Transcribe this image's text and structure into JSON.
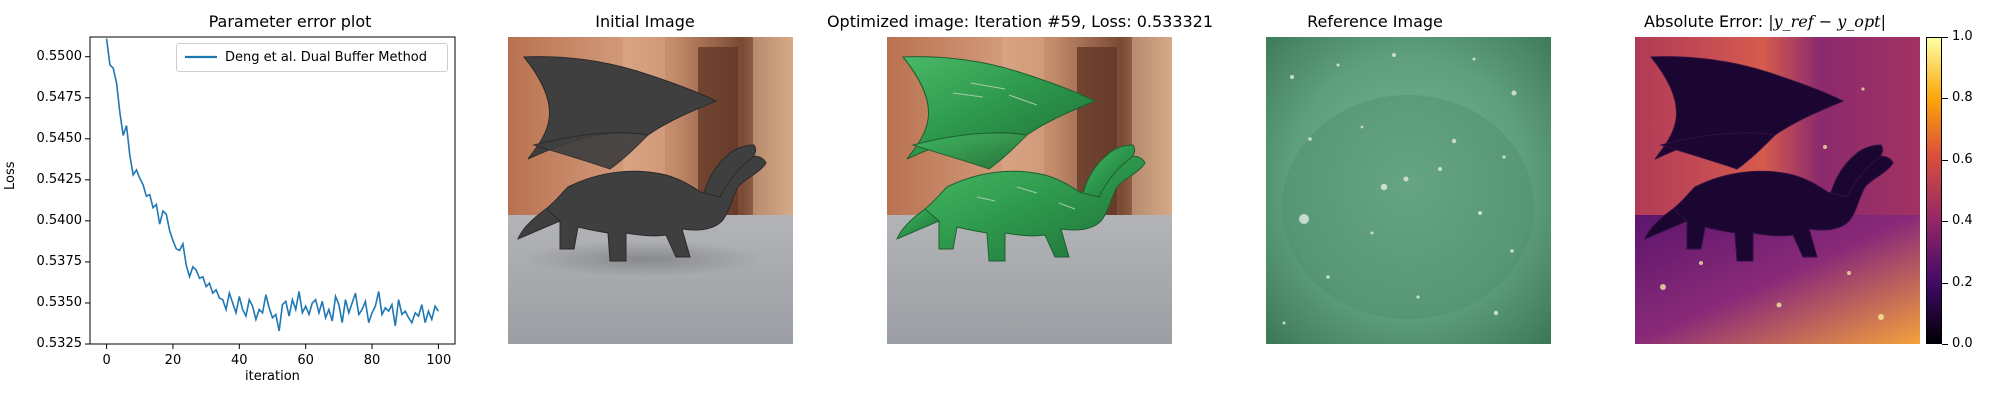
{
  "panels": {
    "plot": {
      "title": "Parameter error plot"
    },
    "initial": {
      "title": "Initial Image"
    },
    "optimized": {
      "title": "Optimized image: Iteration #59, Loss: 0.533321"
    },
    "reference": {
      "title": "Reference Image"
    },
    "error": {
      "title_prefix": "Absolute Error: ",
      "title_formula": "|y_ref − y_opt|"
    }
  },
  "colors": {
    "line": "#1f77b4",
    "sky_initial": "#c78663",
    "room_dark": "#4a2a20",
    "table_gray": "#a7a9ad",
    "dragon_gray": "#3a3a3a",
    "dragon_green": "#2e9a4d",
    "reference_green": "#5c9c7a",
    "inferno_top": "#fcffa4",
    "inferno_mid": "#bc3754",
    "inferno_bottom": "#000004"
  },
  "chart_data": [
    {
      "type": "line",
      "title": "Parameter error plot",
      "xlabel": "iteration",
      "ylabel": "Loss",
      "xlim": [
        -5,
        105
      ],
      "ylim": [
        0.5325,
        0.5512
      ],
      "xticks": [
        "0",
        "20",
        "40",
        "60",
        "80",
        "100"
      ],
      "yticks": [
        "0.5325",
        "0.5350",
        "0.5375",
        "0.5400",
        "0.5425",
        "0.5450",
        "0.5475",
        "0.5500"
      ],
      "legend": "top-right",
      "grid": false,
      "series": [
        {
          "name": "Deng et al. Dual Buffer Method",
          "x": [
            0,
            1,
            2,
            3,
            4,
            5,
            6,
            7,
            8,
            9,
            10,
            11,
            12,
            13,
            14,
            15,
            16,
            17,
            18,
            19,
            20,
            21,
            22,
            23,
            24,
            25,
            26,
            27,
            28,
            29,
            30,
            31,
            32,
            33,
            34,
            35,
            36,
            37,
            38,
            39,
            40,
            41,
            42,
            43,
            44,
            45,
            46,
            47,
            48,
            49,
            50,
            51,
            52,
            53,
            54,
            55,
            56,
            57,
            58,
            59,
            60,
            61,
            62,
            63,
            64,
            65,
            66,
            67,
            68,
            69,
            70,
            71,
            72,
            73,
            74,
            75,
            76,
            77,
            78,
            79,
            80,
            81,
            82,
            83,
            84,
            85,
            86,
            87,
            88,
            89,
            90,
            91,
            92,
            93,
            94,
            95,
            96,
            97,
            98,
            99,
            100
          ],
          "values": [
            0.5511,
            0.5495,
            0.5493,
            0.5484,
            0.5466,
            0.5452,
            0.5458,
            0.544,
            0.5428,
            0.5431,
            0.5426,
            0.5422,
            0.5415,
            0.5416,
            0.5408,
            0.541,
            0.5398,
            0.5406,
            0.5404,
            0.5394,
            0.5388,
            0.5383,
            0.5382,
            0.5386,
            0.5373,
            0.5366,
            0.5372,
            0.537,
            0.5365,
            0.5366,
            0.536,
            0.5362,
            0.5356,
            0.5358,
            0.5353,
            0.5352,
            0.5346,
            0.5356,
            0.535,
            0.5344,
            0.5354,
            0.5346,
            0.5342,
            0.5352,
            0.5348,
            0.534,
            0.5346,
            0.5344,
            0.5355,
            0.5347,
            0.5341,
            0.5343,
            0.5333,
            0.5349,
            0.5351,
            0.5342,
            0.5352,
            0.5346,
            0.5357,
            0.5344,
            0.5348,
            0.5343,
            0.535,
            0.5352,
            0.5344,
            0.5351,
            0.5341,
            0.5346,
            0.5339,
            0.5354,
            0.5349,
            0.5338,
            0.5352,
            0.5344,
            0.535,
            0.5356,
            0.5343,
            0.5346,
            0.5351,
            0.5338,
            0.5344,
            0.5348,
            0.5357,
            0.5343,
            0.5347,
            0.5345,
            0.5349,
            0.5336,
            0.5352,
            0.5343,
            0.5345,
            0.5341,
            0.5338,
            0.5344,
            0.5342,
            0.5349,
            0.5338,
            0.5345,
            0.534,
            0.5348,
            0.5345
          ]
        }
      ]
    },
    {
      "type": "colorbar",
      "ylim": [
        0,
        1
      ],
      "ticks": [
        "0.0",
        "0.2",
        "0.4",
        "0.6",
        "0.8",
        "1.0"
      ]
    }
  ]
}
